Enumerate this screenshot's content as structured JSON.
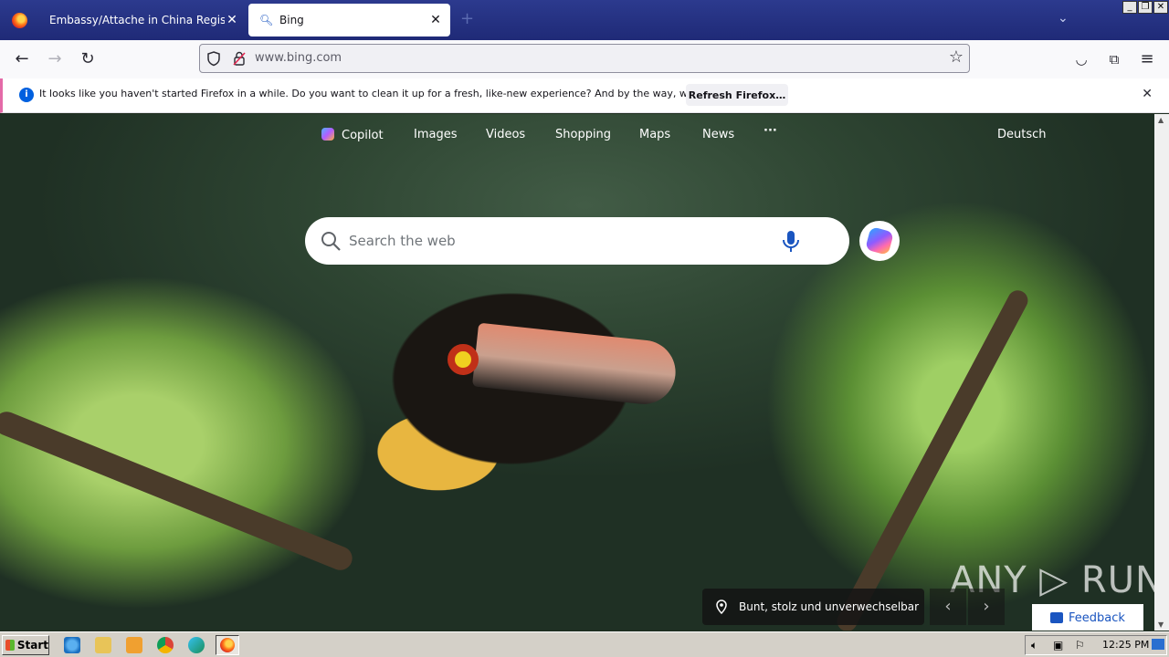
{
  "browser": {
    "tabs": [
      {
        "title": "Embassy/Attache in China Registration",
        "active": false
      },
      {
        "title": "Bing",
        "active": true
      }
    ],
    "url": "www.bing.com"
  },
  "notification": {
    "message": "It looks like you haven't started Firefox in a while. Do you want to clean it up for a fresh, like-new experience? And by the way, welcome back!",
    "button": "Refresh Firefox…"
  },
  "bing": {
    "nav": [
      "Copilot",
      "Images",
      "Videos",
      "Shopping",
      "Maps",
      "News"
    ],
    "more": "···",
    "language": "Deutsch",
    "search_placeholder": "Search the web",
    "caption": "Bunt, stolz und unverwechselbar",
    "feedback": "Feedback"
  },
  "watermark": "ANY ▷ RUN",
  "taskbar": {
    "start": "Start",
    "clock": "12:25 PM"
  },
  "colors": {
    "tabstrip": "#1f2a77",
    "accent": "#0060df",
    "feedback": "#1a55c0"
  }
}
